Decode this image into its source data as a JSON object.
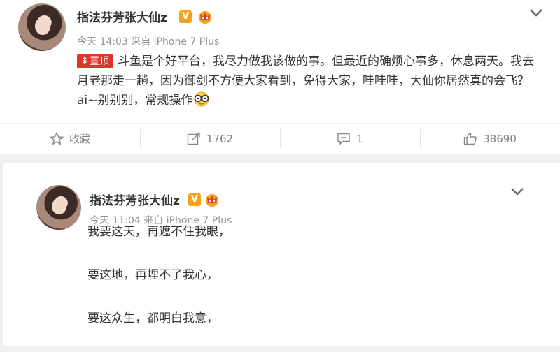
{
  "post1": {
    "username": "指法芬芳张大仙z",
    "verified_badge": "V",
    "time": "今天 14:03",
    "source": "来自 iPhone 7 Plus",
    "pin_label": "置顶",
    "text": "斗鱼是个好平台，我尽力做我该做的事。但最近的确烦心事多，休息两天。我去月老那走一趟，因为御剑不方便大家看到，免得大家，哇哇哇，大仙你居然真的会飞？ai~别别别，常规操作",
    "actions": {
      "favorite_label": "收藏",
      "repost_count": "1762",
      "comment_count": "1",
      "like_count": "38690"
    }
  },
  "post2": {
    "username": "指法芬芳张大仙z",
    "verified_badge": "V",
    "time": "今天 11:04",
    "source": "来自 iPhone 7 Plus",
    "lines": [
      "我要这天，再遮不住我眼，",
      "要这地，再埋不了我心，",
      "要这众生，都明白我意，"
    ]
  },
  "colors": {
    "pin_red": "#e0352b",
    "verified_orange": "#f7a21b",
    "meta_gray": "#939393"
  }
}
